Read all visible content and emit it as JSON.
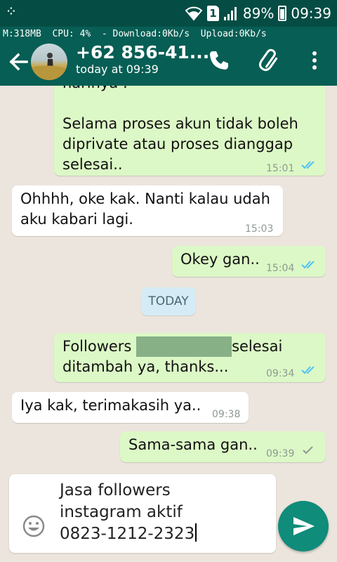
{
  "status_bar": {
    "bbm_icon": "bbm-icon",
    "wifi_icon": "wifi-icon",
    "sim_label": "1",
    "signal_icon": "signal-icon",
    "battery": "89%",
    "time": "09:39"
  },
  "monitor": {
    "memory": "M:318MB",
    "cpu": "CPU: 4%",
    "download": "- Download:0Kb/s",
    "upload": "Upload:0Kb/s"
  },
  "header": {
    "contact_name": "+62 856-41...",
    "last_seen": "today at 09:39",
    "icons": [
      "back-arrow-icon",
      "phone-icon",
      "attach-icon",
      "more-vert-icon"
    ]
  },
  "messages": [
    {
      "direction": "out",
      "text_lines": [
        "Selama proses akun tidak boleh",
        "diprivate atau proses dianggap",
        "selesai.."
      ],
      "partial_top": "harinya :",
      "time": "15:01",
      "read": true
    },
    {
      "direction": "in",
      "text_lines": [
        "Ohhhh, oke kak. Nanti kalau udah",
        "aku kabari lagi."
      ],
      "time": "15:03"
    },
    {
      "direction": "out",
      "text_lines": [
        "Okey gan.."
      ],
      "time": "15:04",
      "read": true
    },
    {
      "direction": "out",
      "text_lines": [
        "Followers",
        "selesai",
        "ditambah ya, thanks..."
      ],
      "time": "09:34",
      "read": true
    },
    {
      "direction": "in",
      "text_lines": [
        "Iya kak, terimakasih ya.."
      ],
      "time": "09:38"
    },
    {
      "direction": "out",
      "text_lines": [
        "Sama-sama gan.."
      ],
      "time": "09:39",
      "read": false
    }
  ],
  "day_divider": "TODAY",
  "composer": {
    "lines": [
      "Jasa followers",
      "instagram aktif",
      "0823-1212-2323"
    ],
    "emoji_icon": "emoji-icon",
    "send_icon": "send-icon"
  },
  "colors": {
    "header": "#075e54",
    "status_bar": "#054d44",
    "outgoing_bubble": "#dcf8c6",
    "incoming_bubble": "#ffffff",
    "read_ticks": "#4fc3f7",
    "send_button": "#0f8c7a"
  }
}
